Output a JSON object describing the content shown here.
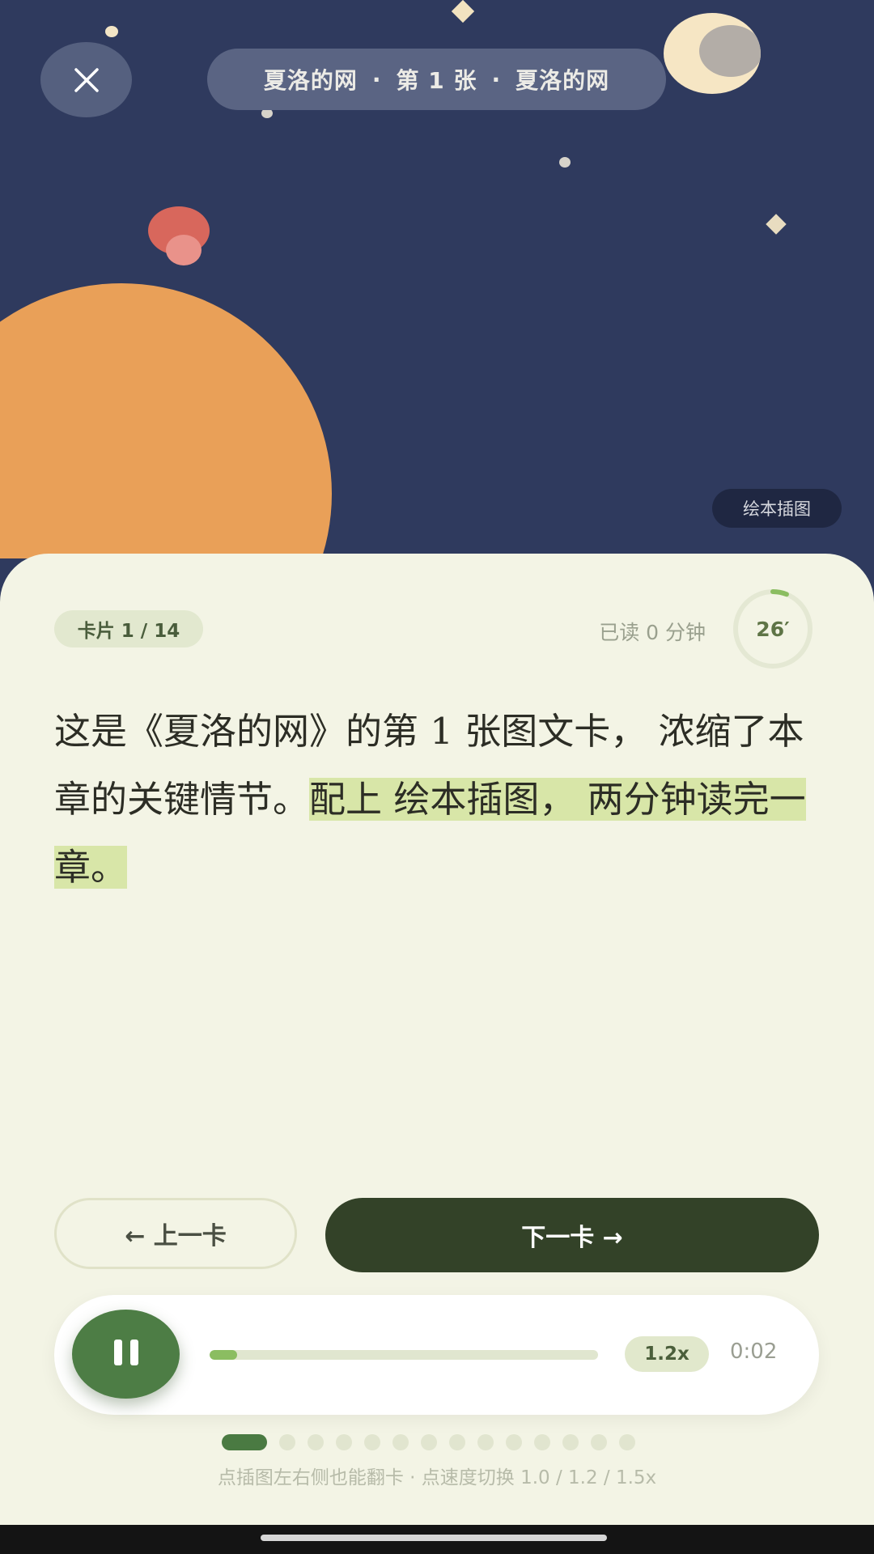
{
  "header": {
    "title_parts": [
      "夏洛的网",
      "第 1 张",
      "夏洛的网"
    ],
    "separator": "·",
    "close_icon": "close-icon"
  },
  "illustration": {
    "badge": "绘本插图"
  },
  "card": {
    "counter": "卡片 1 / 14",
    "read_time": "已读 0 分钟",
    "ring_label": "26′",
    "ring_progress": 0.06,
    "text_plain": "这是《夏洛的网》的第 1 张图文卡， 浓缩了本章的关键情节。",
    "text_highlight": "配上 绘本插图， 两分钟读完一章。"
  },
  "nav": {
    "prev": "← 上一卡",
    "next": "下一卡 →"
  },
  "player": {
    "state_icon": "pause-icon",
    "progress": 0.07,
    "speed": "1.2x",
    "time": "0:02"
  },
  "pager": {
    "total": 14,
    "current": 1
  },
  "hint": "点插图左右侧也能翻卡 · 点速度切换 1.0 / 1.2 / 1.5x",
  "colors": {
    "sky": "#2f3a5e",
    "card_bg": "#f3f4e5",
    "accent": "#4d7d45",
    "highlight": "#d8e6a8",
    "next_btn": "#334228"
  }
}
